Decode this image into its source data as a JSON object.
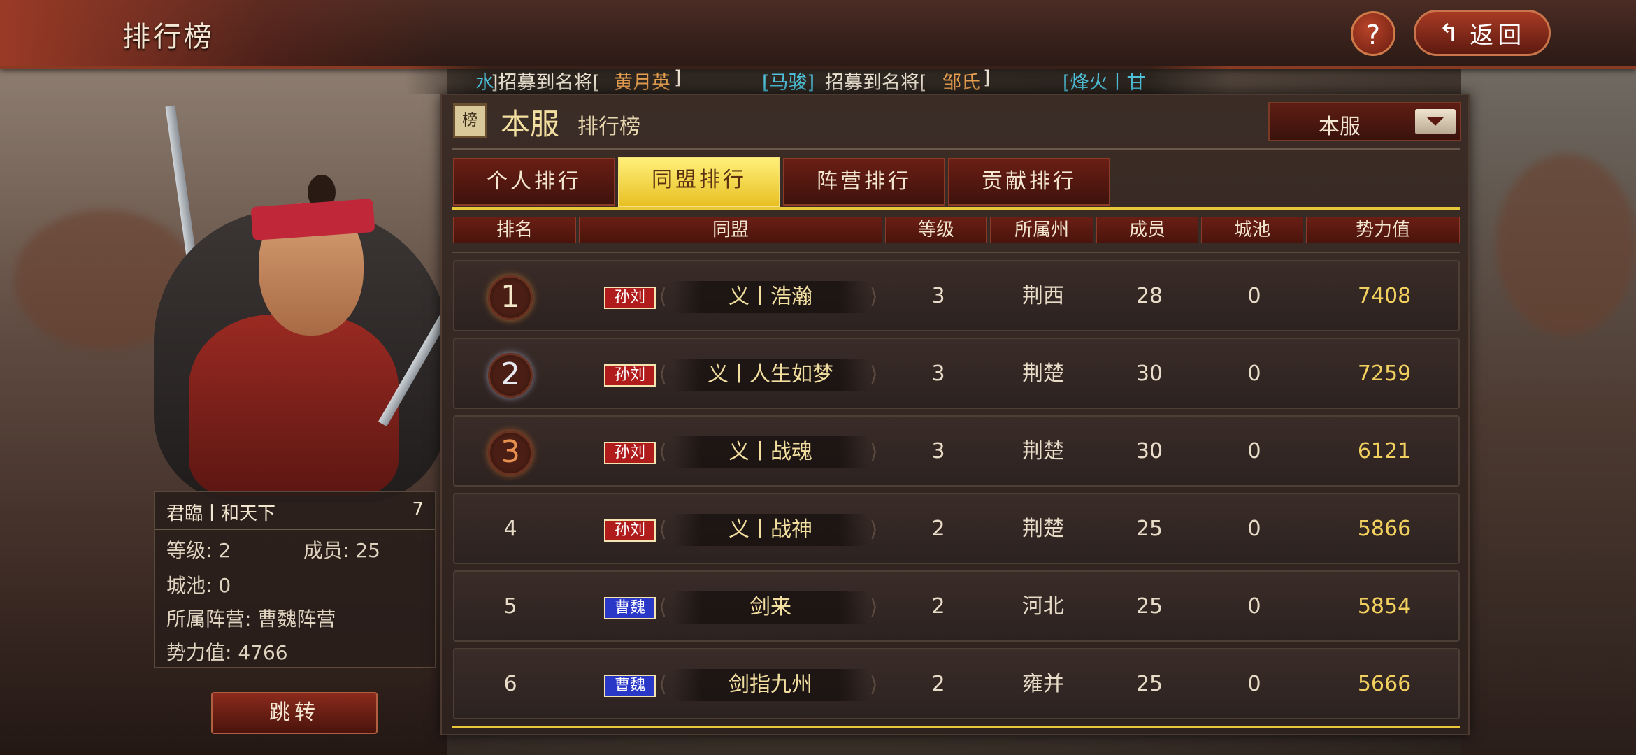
{
  "page": {
    "title": "排行榜"
  },
  "header": {
    "help_label": "?",
    "back_label": "返回",
    "back_icon": "return-arrow-icon"
  },
  "ticker": [
    {
      "text": "水",
      "color": "cyan"
    },
    {
      "text": "]招募到名将[",
      "color": "white"
    },
    {
      "text": "黄月英",
      "color": "orange"
    },
    {
      "text": "]",
      "color": "white"
    },
    {
      "text": "[马骏]",
      "color": "cyan"
    },
    {
      "text": "招募到名将[",
      "color": "white"
    },
    {
      "text": "邹氏",
      "color": "orange"
    },
    {
      "text": "]",
      "color": "white"
    },
    {
      "text": "[烽火丨甘",
      "color": "cyan"
    }
  ],
  "alliance_card": {
    "name": "君臨丨和天下",
    "rank": "7",
    "level_line": "等级: 2",
    "members_line": "成员: 25",
    "cities_line": "城池: 0",
    "camp_line": "所属阵营: 曹魏阵营",
    "power_line": "势力值: 4766",
    "jump_label": "跳转"
  },
  "panel": {
    "icon_glyph": "榜",
    "title": "本服",
    "subtitle": "排行榜",
    "server_select": {
      "value": "本服"
    },
    "tabs": [
      {
        "label": "个人排行",
        "active": false
      },
      {
        "label": "同盟排行",
        "active": true
      },
      {
        "label": "阵营排行",
        "active": false
      },
      {
        "label": "贡献排行",
        "active": false
      }
    ],
    "columns": [
      "排名",
      "同盟",
      "等级",
      "所属州",
      "成员",
      "城池",
      "势力值"
    ]
  },
  "rows": [
    {
      "rank": "1",
      "camp": "孙刘",
      "camp_color": "#b01c1c",
      "name": "义丨浩瀚",
      "level": "3",
      "state": "荆西",
      "members": "28",
      "cities": "0",
      "power": "7408"
    },
    {
      "rank": "2",
      "camp": "孙刘",
      "camp_color": "#b01c1c",
      "name": "义丨人生如梦",
      "level": "3",
      "state": "荆楚",
      "members": "30",
      "cities": "0",
      "power": "7259"
    },
    {
      "rank": "3",
      "camp": "孙刘",
      "camp_color": "#b01c1c",
      "name": "义丨战魂",
      "level": "3",
      "state": "荆楚",
      "members": "30",
      "cities": "0",
      "power": "6121"
    },
    {
      "rank": "4",
      "camp": "孙刘",
      "camp_color": "#b01c1c",
      "name": "义丨战神",
      "level": "2",
      "state": "荆楚",
      "members": "25",
      "cities": "0",
      "power": "5866"
    },
    {
      "rank": "5",
      "camp": "曹魏",
      "camp_color": "#2a38c8",
      "name": "剑来",
      "level": "2",
      "state": "河北",
      "members": "25",
      "cities": "0",
      "power": "5854"
    },
    {
      "rank": "6",
      "camp": "曹魏",
      "camp_color": "#2a38c8",
      "name": "剑指九州",
      "level": "2",
      "state": "雍并",
      "members": "25",
      "cities": "0",
      "power": "5666"
    }
  ],
  "colors": {
    "accent_gold": "#e8c838",
    "power_text": "#f2d060",
    "tab_active": "#f4dc4a"
  }
}
